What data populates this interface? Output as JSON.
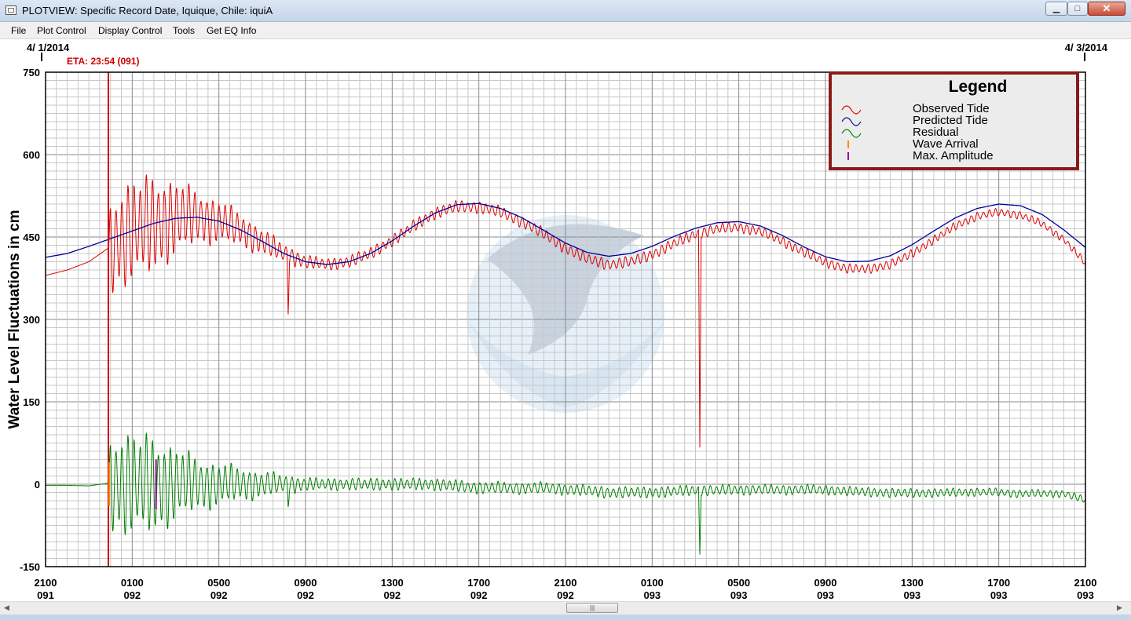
{
  "window": {
    "title": "PLOTVIEW: Specific Record Date, Iquique, Chile: iquiA",
    "minimize": "▁",
    "maximize": "□",
    "close": "✕"
  },
  "menu": [
    "File",
    "Plot Control",
    "Display Control",
    "Tools",
    "Get EQ Info"
  ],
  "header": {
    "start_date": "4/ 1/2014",
    "end_date": "4/ 3/2014",
    "eta": "ETA: 23:54 (091)"
  },
  "colors": {
    "observed": "#dd0000",
    "predicted": "#000099",
    "residual": "#008000",
    "arrival": "#ff8c00",
    "max_amp": "#990099",
    "legend_border": "#8b1a1a",
    "eta": "#cc0000"
  },
  "legend": {
    "title": "Legend",
    "items": [
      {
        "label": "Observed Tide",
        "color": "#dd0000",
        "symbol": "wave"
      },
      {
        "label": "Predicted Tide",
        "color": "#000099",
        "symbol": "wave"
      },
      {
        "label": "Residual",
        "color": "#008000",
        "symbol": "wave"
      },
      {
        "label": "Wave Arrival",
        "color": "#ff8c00",
        "symbol": "bar"
      },
      {
        "label": "Max. Amplitude",
        "color": "#990099",
        "symbol": "bar"
      }
    ]
  },
  "chart_data": {
    "type": "line",
    "ylabel": "Water Level Fluctuations in cm",
    "ylim": [
      -150,
      750
    ],
    "yticks": [
      -150,
      0,
      150,
      300,
      450,
      600,
      750
    ],
    "xlim_hours": [
      0,
      48
    ],
    "xticks": [
      {
        "time": "2100",
        "day": "091"
      },
      {
        "time": "0100",
        "day": "092"
      },
      {
        "time": "0500",
        "day": "092"
      },
      {
        "time": "0900",
        "day": "092"
      },
      {
        "time": "1300",
        "day": "092"
      },
      {
        "time": "1700",
        "day": "092"
      },
      {
        "time": "2100",
        "day": "092"
      },
      {
        "time": "0100",
        "day": "093"
      },
      {
        "time": "0500",
        "day": "093"
      },
      {
        "time": "0900",
        "day": "093"
      },
      {
        "time": "1300",
        "day": "093"
      },
      {
        "time": "1700",
        "day": "093"
      },
      {
        "time": "2100",
        "day": "093"
      }
    ],
    "eta_hour": 2.9,
    "max_amp_hour": 5.1,
    "series": [
      {
        "name": "Predicted Tide",
        "x": [
          0,
          1,
          2,
          3,
          4,
          5,
          6,
          7,
          8,
          9,
          10,
          11,
          12,
          13,
          14,
          15,
          16,
          17,
          18,
          19,
          20,
          21,
          22,
          23,
          24,
          25,
          26,
          27,
          28,
          29,
          30,
          31,
          32,
          33,
          34,
          35,
          36,
          37,
          38,
          39,
          40,
          41,
          42,
          43,
          44,
          45,
          46,
          47,
          48
        ],
        "y": [
          413,
          420,
          433,
          447,
          461,
          475,
          484,
          486,
          479,
          463,
          442,
          420,
          405,
          400,
          405,
          420,
          443,
          470,
          494,
          509,
          511,
          502,
          485,
          462,
          439,
          422,
          415,
          420,
          433,
          451,
          466,
          476,
          478,
          470,
          453,
          432,
          414,
          405,
          406,
          416,
          436,
          461,
          485,
          502,
          510,
          507,
          491,
          463,
          431
        ]
      },
      {
        "name": "Observed Tide",
        "x": [
          0,
          1,
          2,
          2.9,
          4,
          5,
          6,
          7,
          8,
          9,
          10,
          11,
          12,
          13,
          14,
          15,
          16,
          17,
          18,
          19,
          20,
          21,
          22,
          23,
          24,
          25,
          26,
          27,
          28,
          29,
          30,
          31,
          32,
          33,
          34,
          35,
          36,
          37,
          38,
          39,
          40,
          41,
          42,
          43,
          44,
          45,
          46,
          47,
          48
        ],
        "y": [
          380,
          390,
          405,
          430,
          461,
          475,
          484,
          486,
          479,
          463,
          442,
          420,
          405,
          400,
          405,
          420,
          443,
          470,
          494,
          505,
          505,
          495,
          478,
          455,
          430,
          410,
          400,
          405,
          418,
          438,
          455,
          465,
          468,
          460,
          443,
          422,
          404,
          392,
          392,
          400,
          420,
          445,
          470,
          488,
          495,
          490,
          474,
          446,
          402
        ]
      },
      {
        "name": "Residual",
        "x": [
          0,
          1,
          2,
          2.9,
          4,
          5,
          6,
          7,
          8,
          9,
          10,
          11,
          12,
          13,
          14,
          15,
          16,
          17,
          18,
          19,
          20,
          21,
          22,
          23,
          24,
          25,
          26,
          27,
          28,
          29,
          30,
          31,
          32,
          33,
          34,
          35,
          36,
          37,
          38,
          39,
          40,
          41,
          42,
          43,
          44,
          45,
          46,
          47,
          48
        ],
        "y": [
          -2,
          -2,
          -3,
          2,
          0,
          0,
          0,
          0,
          0,
          0,
          0,
          0,
          0,
          0,
          0,
          0,
          0,
          0,
          0,
          -4,
          -6,
          -7,
          -7,
          -7,
          -9,
          -12,
          -15,
          -15,
          -15,
          -13,
          -11,
          -11,
          -10,
          -10,
          -10,
          -10,
          -10,
          -13,
          -14,
          -16,
          -16,
          -16,
          -15,
          -14,
          -15,
          -17,
          -17,
          -17,
          -29
        ]
      }
    ],
    "oscillation": {
      "period_hours": 0.28,
      "amplitude_cm": [
        [
          2.9,
          0
        ],
        [
          3.0,
          210
        ],
        [
          5.0,
          200
        ],
        [
          7.0,
          110
        ],
        [
          9.0,
          70
        ],
        [
          11.0,
          40
        ],
        [
          12.5,
          25
        ],
        [
          20,
          25
        ],
        [
          36,
          20
        ],
        [
          48,
          15
        ]
      ],
      "spikes": [
        {
          "hour": 11.2,
          "value": -95
        },
        {
          "hour": 30.2,
          "value": -390
        }
      ]
    }
  }
}
